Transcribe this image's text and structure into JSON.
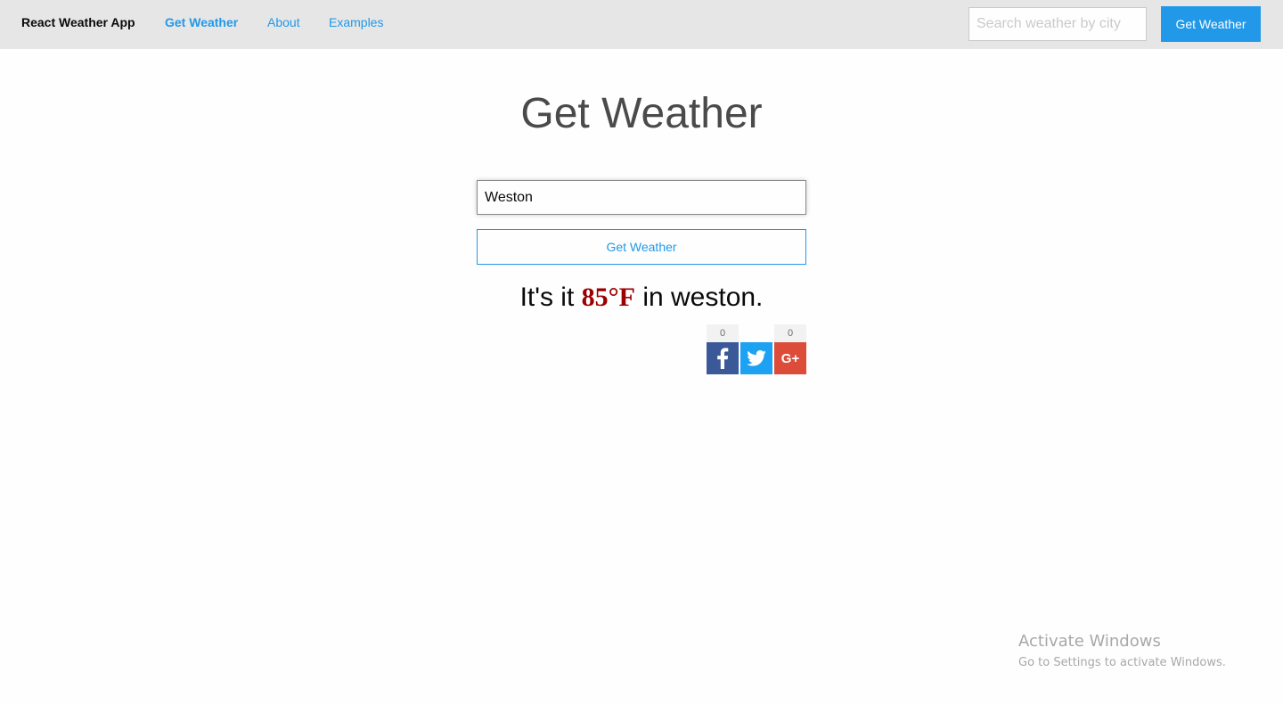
{
  "nav": {
    "brand": "React Weather App",
    "links": [
      {
        "label": "Get Weather",
        "active": true
      },
      {
        "label": "About",
        "active": false
      },
      {
        "label": "Examples",
        "active": false
      }
    ],
    "search_placeholder": "Search weather by city",
    "search_button": "Get Weather"
  },
  "main": {
    "title": "Get Weather",
    "city_input_value": "Weston",
    "button_label": "Get Weather",
    "result": {
      "prefix": "It's it ",
      "temperature": "85°F",
      "suffix": " in weston."
    }
  },
  "share": {
    "facebook": {
      "icon": "facebook-icon",
      "count": "0",
      "color": "#3b5998"
    },
    "twitter": {
      "icon": "twitter-icon",
      "color": "#1da1f2"
    },
    "googleplus": {
      "icon": "google-plus-icon",
      "label": "G+",
      "count": "0",
      "color": "#dd4b39"
    }
  },
  "watermark": {
    "title": "Activate Windows",
    "subtitle": "Go to Settings to activate Windows."
  },
  "colors": {
    "accent": "#2199e8",
    "topbar": "#e6e6e6",
    "temperature": "#9b0000"
  }
}
